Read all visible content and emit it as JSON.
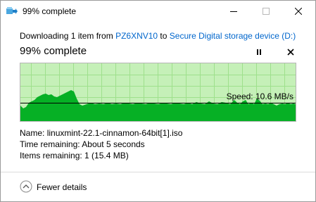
{
  "window": {
    "title": "99% complete",
    "controls": [
      "minimize-icon",
      "maximize-icon",
      "close-icon"
    ]
  },
  "download": {
    "prefix": "Downloading 1 item from ",
    "source": "PZ6XNV10",
    "middle": " to ",
    "destination": "Secure Digital storage device (D:)"
  },
  "progress": {
    "heading": "99% complete",
    "percent": 99,
    "pause_icon": "pause-icon",
    "cancel_icon": "close-icon"
  },
  "graph": {
    "speed_label": "Speed: 10.6 MB/s",
    "colors": {
      "background": "#c5f0b8",
      "fill": "#06b025",
      "line": "#000000"
    }
  },
  "info": {
    "name_label": "Name:",
    "name_value": "linuxmint-22.1-cinnamon-64bit[1].iso",
    "time_label": "Time remaining:",
    "time_value": "About 5 seconds",
    "items_label": "Items remaining:",
    "items_value": "1 (15.4 MB)"
  },
  "details": {
    "label": "Fewer details",
    "icon": "chevron-up-icon"
  }
}
